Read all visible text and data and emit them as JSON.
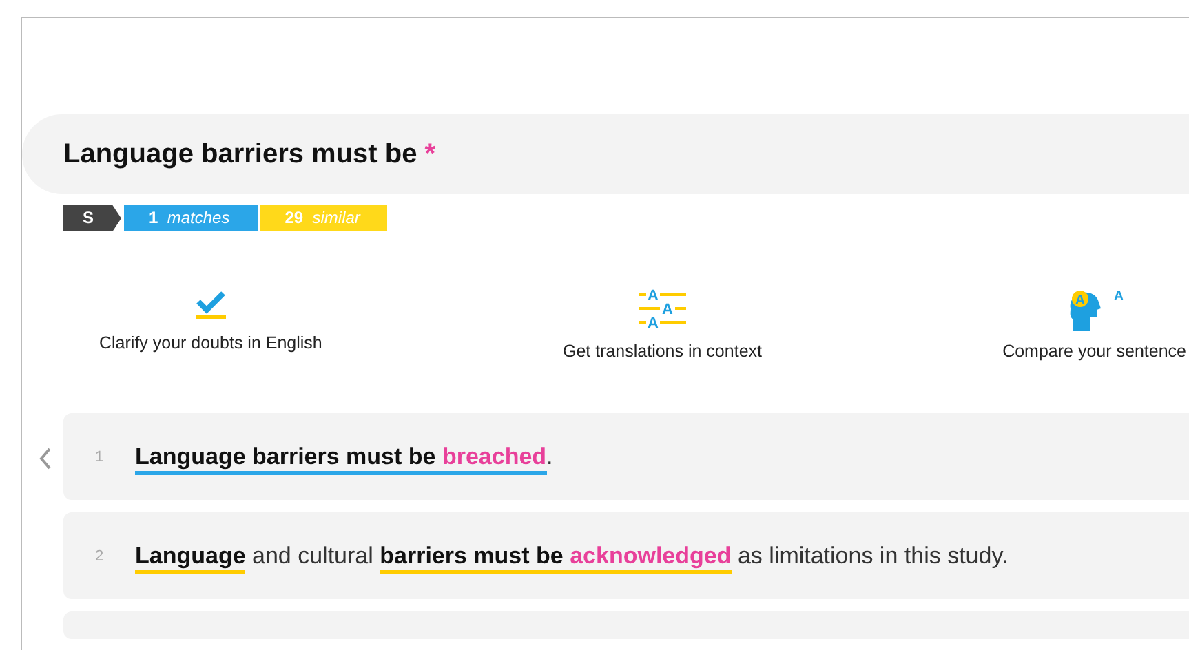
{
  "search": {
    "query": "Language barriers must be",
    "wildcard": "*"
  },
  "tags": [
    {
      "kind": "step",
      "label": "S",
      "color": "#444444"
    },
    {
      "kind": "count",
      "count": "1",
      "label": "matches",
      "color": "#2ba6e8"
    },
    {
      "kind": "count",
      "count": "29",
      "label": "similar",
      "color": "#ffd91a"
    }
  ],
  "features": [
    {
      "kind": "check",
      "label": "Clarify your doubts in English"
    },
    {
      "kind": "translate",
      "label": "Get translations in context",
      "icon_text": [
        "A",
        "A",
        "A"
      ]
    },
    {
      "kind": "head",
      "label": "Compare your sentence",
      "icon_text": [
        "A",
        "A"
      ]
    }
  ],
  "results": [
    {
      "number": "1",
      "selected": false,
      "groups": [
        {
          "color": "#2ba6e8",
          "parts": [
            {
              "kind": "match",
              "text": "Language barriers must be "
            },
            {
              "kind": "fill",
              "text": "breached"
            }
          ]
        },
        {
          "parts": [
            {
              "kind": "plain",
              "text": "."
            }
          ]
        }
      ]
    },
    {
      "number": "2",
      "selected": false,
      "groups": [
        {
          "color": "#ffcc00",
          "parts": [
            {
              "kind": "match",
              "text": "Language"
            }
          ]
        },
        {
          "parts": [
            {
              "kind": "plain",
              "text": " and cultural "
            }
          ]
        },
        {
          "color": "#ffcc00",
          "parts": [
            {
              "kind": "match",
              "text": "barriers must be "
            },
            {
              "kind": "fill",
              "text": "acknowledged"
            }
          ]
        },
        {
          "parts": [
            {
              "kind": "plain",
              "text": " as limitations in this study."
            }
          ]
        }
      ]
    }
  ]
}
